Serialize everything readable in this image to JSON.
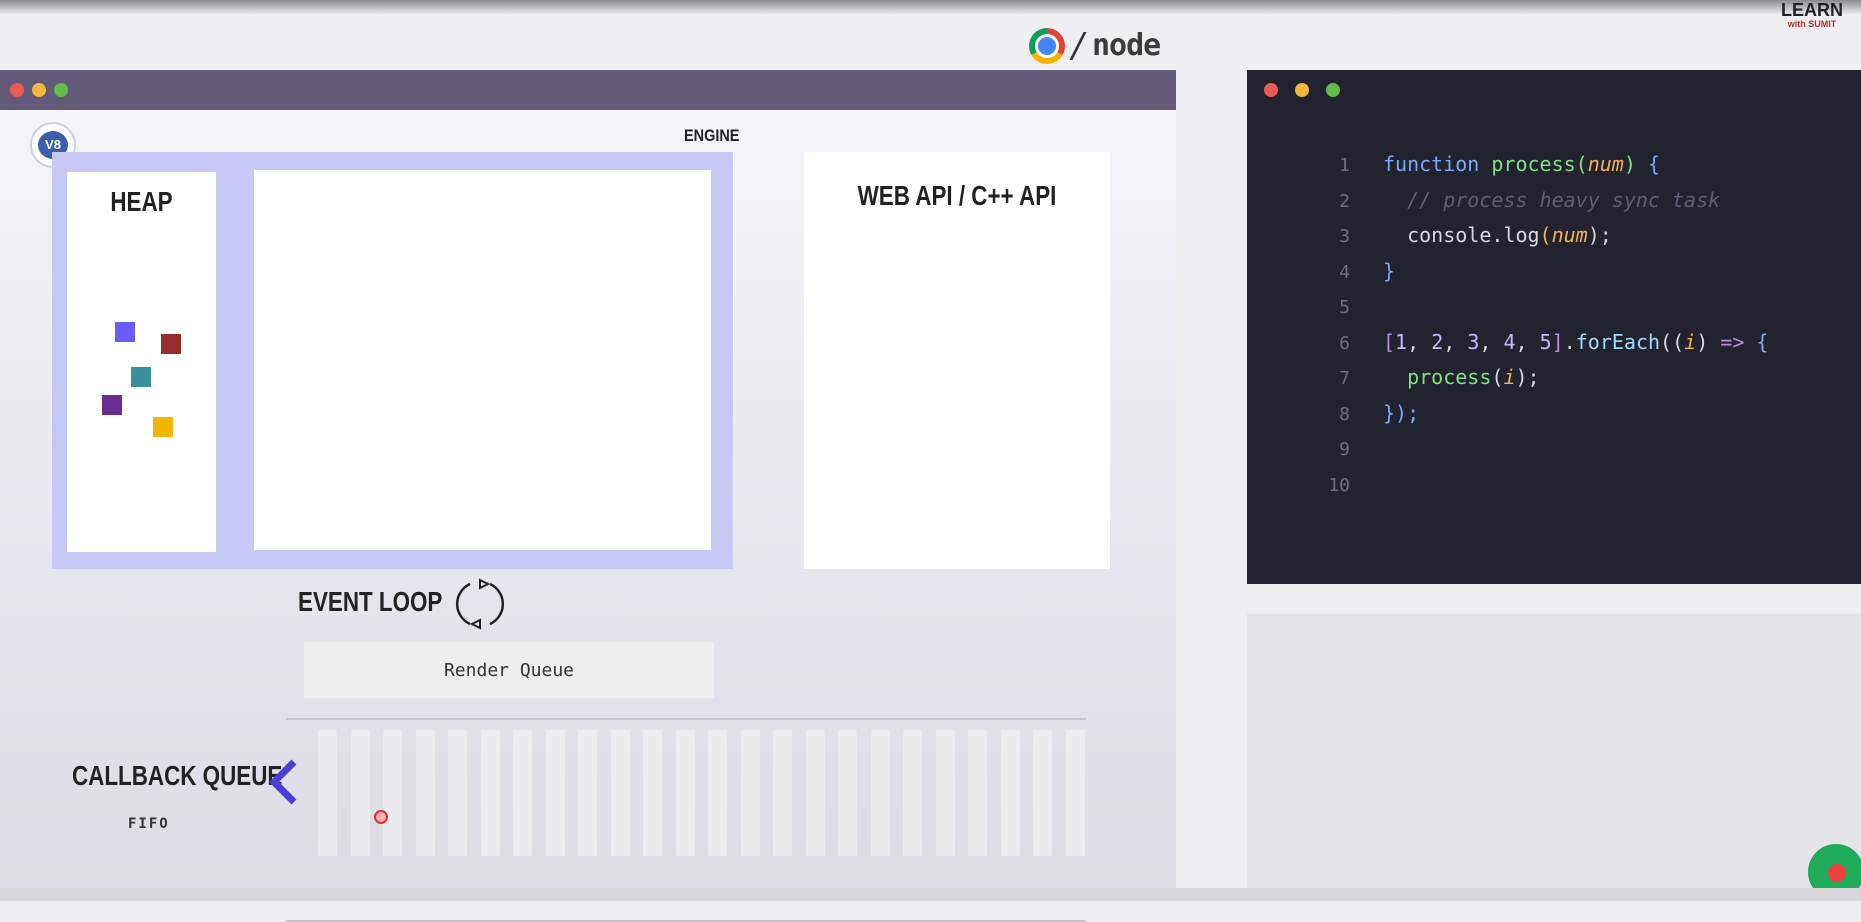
{
  "header": {
    "runtime_separator": "/",
    "node_logo_text": "node",
    "brand": {
      "line1": "LEARN",
      "line2": "with SUMIT"
    }
  },
  "visualizer": {
    "engine_label": "ENGINE",
    "heap_label": "HEAP",
    "web_api_label": "WEB API / C++ API",
    "event_loop_label": "EVENT LOOP",
    "render_queue_label": "Render Queue",
    "callback_queue_label": "CALLBACK QUEUE",
    "fifo_label": "FIFO",
    "heap_object_colors": [
      "#6a5cf4",
      "#992d2d",
      "#3a8f9e",
      "#6b2c8f",
      "#f4b400"
    ],
    "callback_queue_slot_count": 24
  },
  "editor": {
    "lines": [
      {
        "n": "1"
      },
      {
        "n": "2"
      },
      {
        "n": "3"
      },
      {
        "n": "4"
      },
      {
        "n": "5"
      },
      {
        "n": "6"
      },
      {
        "n": "7"
      },
      {
        "n": "8"
      },
      {
        "n": "9"
      },
      {
        "n": "10"
      }
    ],
    "tokens": {
      "l1_kw": "function",
      "l1_fn": "process",
      "l1_open": "(",
      "l1_param": "num",
      "l1_close": ") ",
      "l1_brace": "{",
      "l2_comment": "// process heavy sync task",
      "l3_obj": "console.",
      "l3_fn": "log",
      "l3_open": "(",
      "l3_param": "num",
      "l3_close": ");",
      "l4_brace": "}",
      "l6_lb": "[",
      "l6_n1": "1",
      "l6_c1": ", ",
      "l6_n2": "2",
      "l6_c2": ", ",
      "l6_n3": "3",
      "l6_c3": ", ",
      "l6_n4": "4",
      "l6_c4": ", ",
      "l6_n5": "5",
      "l6_rb": "]",
      "l6_dot": ".",
      "l6_fn": "forEach",
      "l6_open": "((",
      "l6_param": "i",
      "l6_close": ") ",
      "l6_arrow": "=>",
      "l6_brace": " {",
      "l7_fn": "process",
      "l7_open": "(",
      "l7_param": "i",
      "l7_close": ");",
      "l8_end": "});"
    }
  },
  "colors": {
    "titlebar": "#625a78",
    "engine_bg": "#c8c8f4",
    "editor_bg": "#22232e",
    "chevron": "#4b3fd8"
  }
}
